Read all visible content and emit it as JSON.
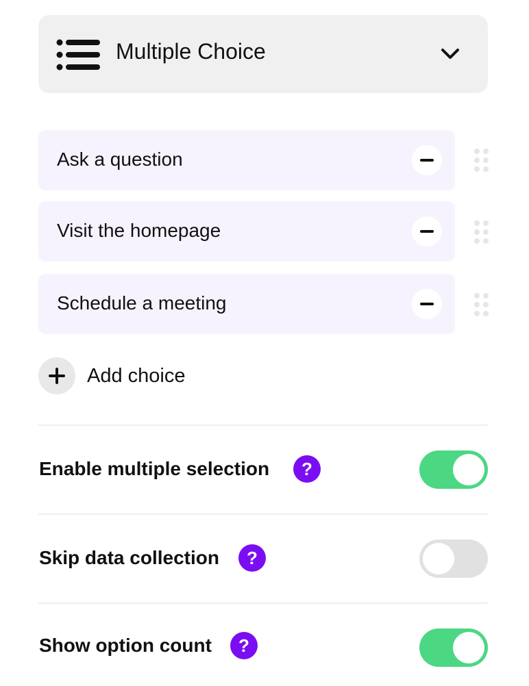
{
  "question_type": {
    "label": "Multiple Choice",
    "icon": "list-icon",
    "dropdown_icon": "chevron-down-icon"
  },
  "choices": [
    {
      "label": "Ask a question"
    },
    {
      "label": "Visit the homepage"
    },
    {
      "label": "Schedule a meeting"
    }
  ],
  "add_choice": {
    "label": "Add choice",
    "icon": "plus-icon"
  },
  "settings": [
    {
      "label": "Enable multiple selection",
      "help_icon": "?",
      "enabled": true
    },
    {
      "label": "Skip data collection",
      "help_icon": "?",
      "enabled": false
    },
    {
      "label": "Show option count",
      "help_icon": "?",
      "enabled": true
    }
  ],
  "colors": {
    "accent_purple": "#7b0df2",
    "toggle_on": "#4cd783",
    "toggle_off": "#e1e1e1",
    "choice_bg": "#f7f3fe"
  }
}
